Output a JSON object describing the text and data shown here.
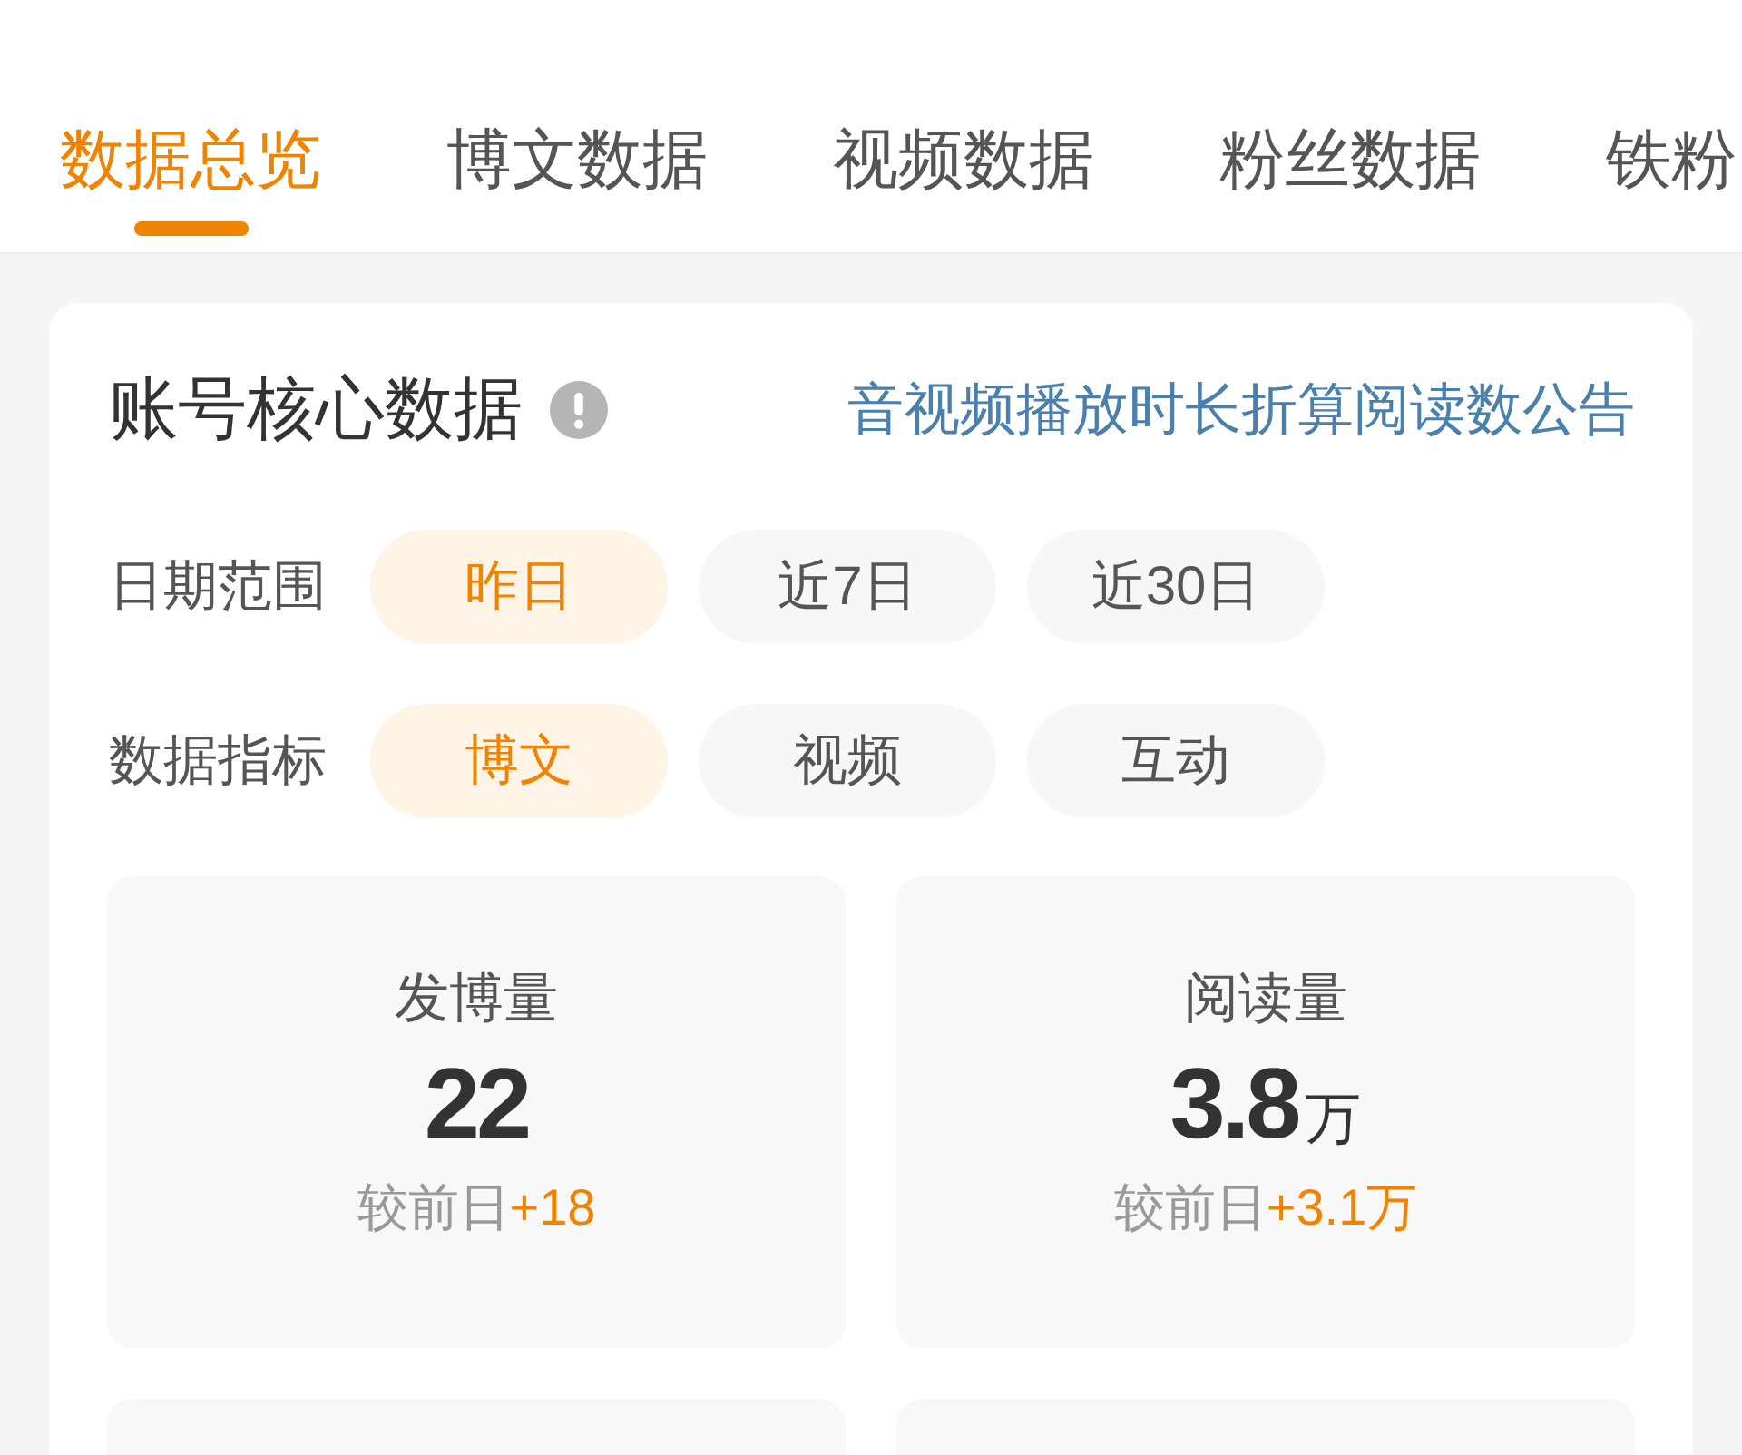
{
  "tabs": [
    {
      "label": "数据总览",
      "selected": true
    },
    {
      "label": "博文数据",
      "selected": false
    },
    {
      "label": "视频数据",
      "selected": false
    },
    {
      "label": "粉丝数据",
      "selected": false
    },
    {
      "label": "铁粉",
      "selected": false
    }
  ],
  "core_data": {
    "title": "账号核心数据",
    "notice_link": "音视频播放时长折算阅读数公告",
    "filters": [
      {
        "label": "日期范围",
        "options": [
          {
            "label": "昨日",
            "selected": true
          },
          {
            "label": "近7日",
            "selected": false
          },
          {
            "label": "近30日",
            "selected": false
          }
        ]
      },
      {
        "label": "数据指标",
        "options": [
          {
            "label": "博文",
            "selected": true
          },
          {
            "label": "视频",
            "selected": false
          },
          {
            "label": "互动",
            "selected": false
          }
        ]
      }
    ],
    "stats": [
      {
        "label": "发博量",
        "value": "22",
        "comparison_label": "较前日",
        "change": "+18"
      },
      {
        "label": "阅读量",
        "value": "3.8",
        "unit": "万",
        "comparison_label": "较前日",
        "change": "+3.1万"
      }
    ]
  }
}
